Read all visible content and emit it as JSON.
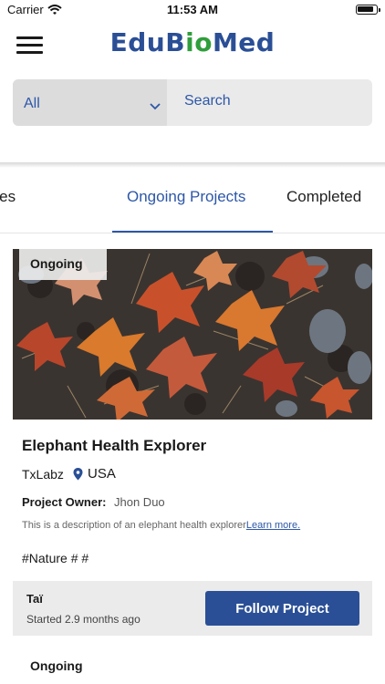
{
  "status_bar": {
    "carrier": "Carrier",
    "time": "11:53 AM"
  },
  "header": {
    "logo": {
      "part1": "EduB",
      "part2": "io",
      "part3": "Med"
    }
  },
  "search": {
    "filter_value": "All",
    "placeholder": "Search"
  },
  "tabs": [
    {
      "label": "Opportunities"
    },
    {
      "label": "Ongoing Projects",
      "active": true
    },
    {
      "label": "Completed"
    }
  ],
  "project": {
    "status": "Ongoing",
    "title": "Elephant Health Explorer",
    "lab": "TxLabz",
    "country": "USA",
    "owner_label": "Project Owner:",
    "owner": "Jhon Duo",
    "description": "This is a description of an elephant health explorer",
    "learn_more": "Learn more.",
    "tags": "#Nature # #",
    "follower": "Taï",
    "started": "Started 2.9 months ago",
    "follow_label": "Follow Project"
  },
  "next_project": {
    "status": "Ongoing"
  },
  "colors": {
    "brand_blue": "#2a4f96",
    "brand_green": "#2f9e3c",
    "accent": "#2d57a8"
  }
}
